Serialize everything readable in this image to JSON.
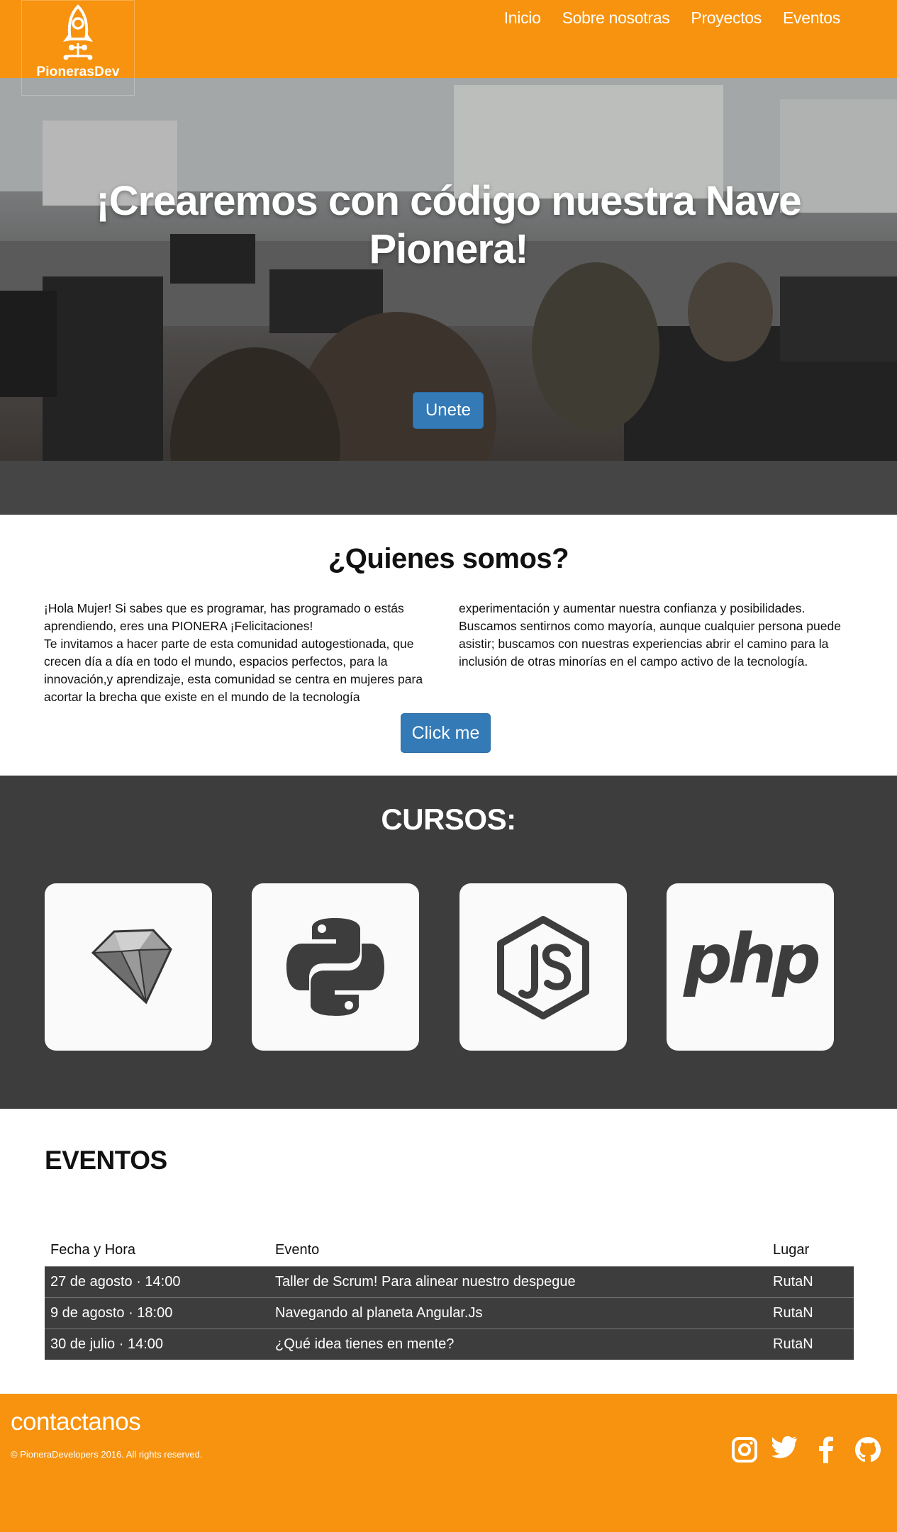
{
  "brand": {
    "logo_text": "PionerasDev"
  },
  "nav": {
    "items": [
      "Inicio",
      "Sobre nosotras",
      "Proyectos",
      "Eventos"
    ]
  },
  "hero": {
    "title": "¡Crearemos con código nuestra Nave Pionera!",
    "button": "Unete"
  },
  "about": {
    "title": "¿Quienes somos?",
    "col_left": "¡Hola Mujer! Si sabes que es programar, has programado o estás aprendiendo, eres una PIONERA ¡Felicitaciones! Te invitamos a hacer parte de esta comunidad autogestionada, que crecen día a día en todo el mundo, espacios perfectos, para la innovación,y aprendizaje, esta comunidad se centra en mujeres para acortar la brecha que existe en el mundo de la tecnología",
    "col_left_line1": "¡Hola Mujer! Si sabes que es programar, has programado o estás aprendiendo, eres una PIONERA ¡Felicitaciones!",
    "col_left_line2": "Te invitamos a hacer parte de esta comunidad autogestionada, que crecen día a día en todo el mundo, espacios perfectos, para la innovación,y aprendizaje, esta comunidad se centra en mujeres para acortar la brecha que existe en el mundo de la tecnología",
    "col_right": "experimentación y aumentar nuestra confianza y posibilidades. Buscamos sentirnos como mayoría, aunque cualquier persona puede asistir; buscamos con nuestras experiencias abrir el camino para la inclusión de otras minorías en el campo activo de la tecnología.",
    "button": "Click me"
  },
  "courses": {
    "title": "CURSOS:",
    "items": [
      {
        "icon": "ruby-icon"
      },
      {
        "icon": "python-icon"
      },
      {
        "icon": "nodejs-icon"
      },
      {
        "icon": "php-icon",
        "label": "php"
      }
    ]
  },
  "events": {
    "title": "EVENTOS",
    "headers": [
      "Fecha y Hora",
      "Evento",
      "Lugar"
    ],
    "rows": [
      [
        "27 de agosto · 14:00",
        "Taller de Scrum! Para alinear nuestro despegue",
        "RutaN"
      ],
      [
        "9 de agosto · 18:00",
        "Navegando al planeta Angular.Js",
        "RutaN"
      ],
      [
        "30 de julio · 14:00",
        "¿Qué idea tienes en mente?",
        "RutaN"
      ]
    ]
  },
  "footer": {
    "title": "contactanos",
    "copyright": "© PioneraDevelopers 2016. All rights reserved.",
    "social": [
      "instagram-icon",
      "twitter-icon",
      "facebook-icon",
      "github-icon"
    ]
  },
  "colors": {
    "brand_orange": "#f7930f",
    "dark": "#3d3d3d",
    "button_blue": "#337ab7"
  }
}
